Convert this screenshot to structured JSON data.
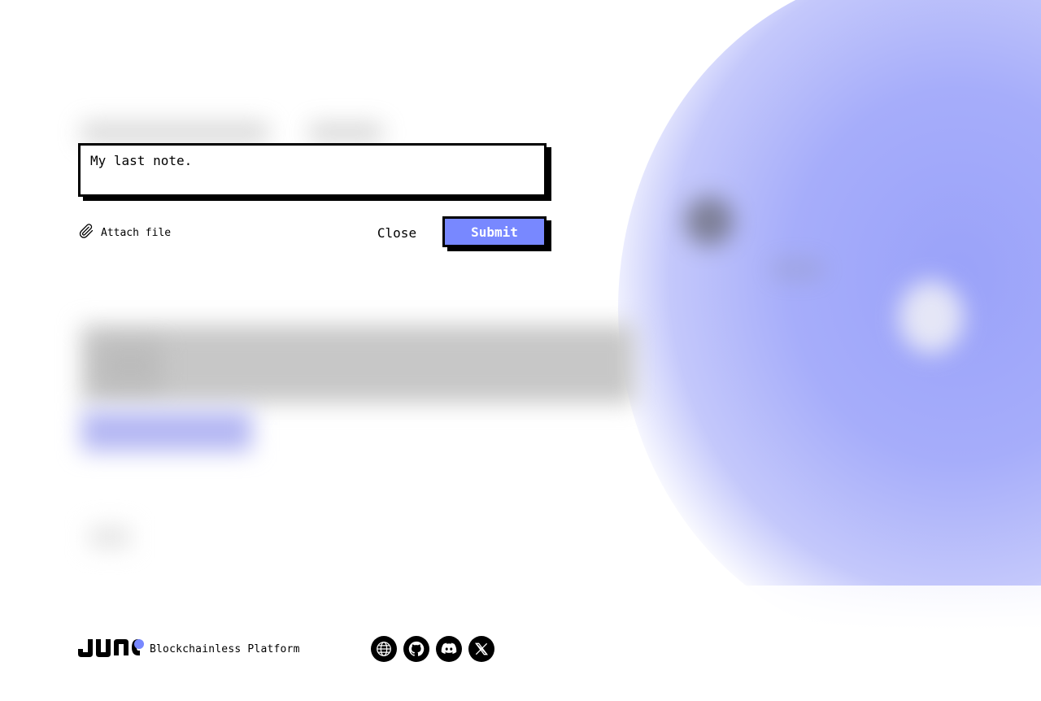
{
  "note": {
    "value": "My last note.",
    "placeholder": ""
  },
  "actions": {
    "attach_label": "Attach file",
    "close_label": "Close",
    "submit_label": "Submit"
  },
  "footer": {
    "logo_text": "JUNO",
    "tagline": "Blockchainless Platform",
    "social_icons": [
      "globe-icon",
      "github-icon",
      "discord-icon",
      "x-icon"
    ]
  },
  "colors": {
    "accent": "#7888ff",
    "border": "#000000",
    "background": "#ffffff"
  }
}
